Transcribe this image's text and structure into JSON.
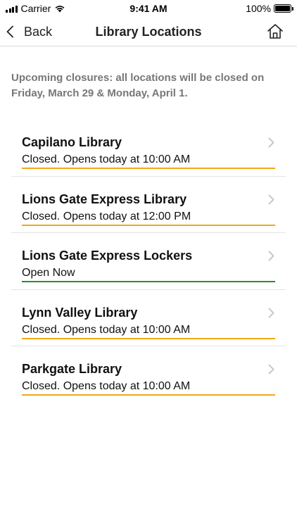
{
  "status_bar": {
    "carrier": "Carrier",
    "time": "9:41 AM",
    "battery": "100%",
    "battery_level": 1.0
  },
  "nav": {
    "back_label": "Back",
    "title": "Library Locations",
    "home_icon": "home-icon"
  },
  "notice": "Upcoming closures: all locations will be closed on Friday, March 29 & Monday, April 1.",
  "colors": {
    "closed": "#f0a81c",
    "open": "#2e8b2e",
    "notice_text": "#777777",
    "chevron": "#c7c7cc"
  },
  "locations": [
    {
      "name": "Capilano Library",
      "status": "Closed. Opens today at 10:00 AM",
      "state": "closed"
    },
    {
      "name": "Lions Gate Express Library",
      "status": "Closed. Opens today at 12:00 PM",
      "state": "closed"
    },
    {
      "name": "Lions Gate Express Lockers",
      "status": "Open Now",
      "state": "open"
    },
    {
      "name": "Lynn Valley Library",
      "status": "Closed. Opens today at 10:00 AM",
      "state": "closed"
    },
    {
      "name": "Parkgate Library",
      "status": "Closed. Opens today at 10:00 AM",
      "state": "closed"
    }
  ]
}
